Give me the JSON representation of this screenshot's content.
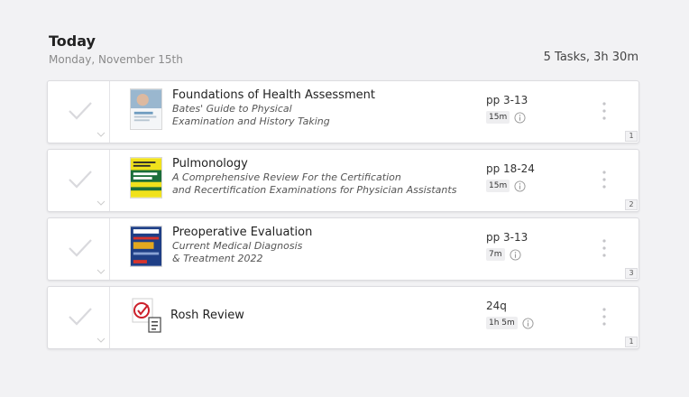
{
  "header": {
    "title": "Today",
    "date": "Monday, November 15th",
    "summary": "5 Tasks, 3h 30m"
  },
  "tasks": [
    {
      "title": "Foundations of Health Assessment",
      "subtitle": "Bates' Guide to Physical\nExamination and History Taking",
      "pages": "pp 3-13",
      "duration": "15m",
      "order": "1",
      "cover_icon": "book-cover-bates",
      "cover_color": "#6f9cc0"
    },
    {
      "title": "Pulmonology",
      "subtitle": "A Comprehensive Review For the Certification\nand Recertification Examinations for Physician Assistants",
      "pages": "pp 18-24",
      "duration": "15m",
      "order": "2",
      "cover_icon": "book-cover-pa-review",
      "cover_color": "#f0e11c"
    },
    {
      "title": "Preoperative Evaluation",
      "subtitle": "Current Medical Diagnosis\n& Treatment 2022",
      "pages": "pp 3-13",
      "duration": "7m",
      "order": "3",
      "cover_icon": "book-cover-cmdt",
      "cover_color": "#1f3f86"
    },
    {
      "title": "Rosh Review",
      "pages": "24q",
      "duration": "1h 5m",
      "order": "1",
      "cover_icon": "rosh-review-icon",
      "cover_color": "#cc1f2a"
    }
  ]
}
